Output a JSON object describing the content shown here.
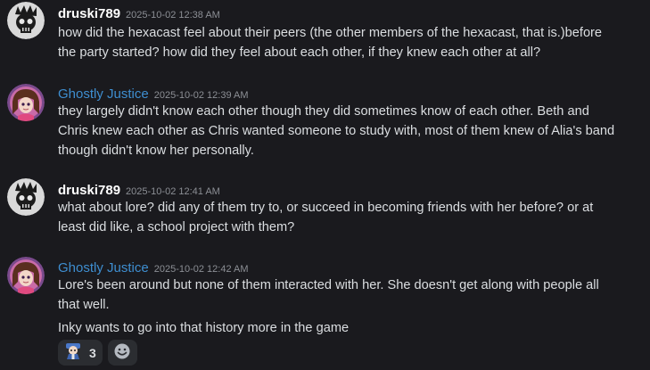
{
  "colors": {
    "background": "#1a1a1e",
    "druski_name": "#ffffff",
    "ghostly_name": "#3e8ed0",
    "timestamp": "#8c8f95",
    "text": "#dbdee1",
    "reaction_bg": "#2b2d31"
  },
  "messages": [
    {
      "author": "druski789",
      "timestamp": "2025-10-02 12:38 AM",
      "avatar_icon": "skull-avatar-icon",
      "lines": [
        "how did the hexacast feel about their peers (the other members of the hexacast, that is.)before",
        "the party started? how did they feel about each other, if they knew each other at all?"
      ]
    },
    {
      "author": "Ghostly Justice",
      "timestamp": "2025-10-02 12:39 AM",
      "avatar_icon": "anime-girl-avatar-icon",
      "lines": [
        "they largely didn't know each other though they did sometimes know of each other. Beth and",
        "Chris knew each other as Chris wanted someone to study with, most of them knew of Alia's band",
        "though didn't know her personally."
      ]
    },
    {
      "author": "druski789",
      "timestamp": "2025-10-02 12:41 AM",
      "avatar_icon": "skull-avatar-icon",
      "lines": [
        "what about lore? did any of them try to, or succeed in becoming friends with her before? or at",
        "least did like, a school project with them?"
      ]
    },
    {
      "author": "Ghostly Justice",
      "timestamp": "2025-10-02 12:42 AM",
      "avatar_icon": "anime-girl-avatar-icon",
      "lines": [
        "Lore's been around but none of them interacted with her. She doesn't get along with people all",
        "that well.",
        "Inky wants to go into that history more in the game"
      ]
    }
  ],
  "reactions": [
    {
      "emoji_icon": "custom-emoji-icon",
      "count": "3"
    }
  ],
  "add_reaction_icon": "smiley-add-reaction-icon"
}
